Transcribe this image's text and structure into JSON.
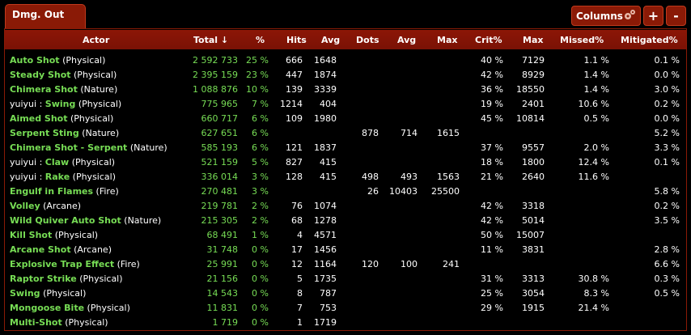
{
  "tab": {
    "label": "Dmg. Out"
  },
  "toolbar": {
    "columns_label": "Columns",
    "plus_label": "+",
    "minus_label": "-"
  },
  "columns": [
    "Actor",
    "Total ↓",
    "%",
    "Hits",
    "Avg",
    "Dots",
    "Avg",
    "Max",
    "Crit%",
    "Max",
    "Missed%",
    "Mitigated%"
  ],
  "rows": [
    {
      "owner": "",
      "skill": "Auto Shot",
      "school": "(Physical)",
      "total": "2 592 733",
      "pct": "25 %",
      "hits": "666",
      "avg": "1648",
      "dots": "",
      "davg": "",
      "dmax": "",
      "crit": "40 %",
      "max": "7129",
      "missed": "1.1 %",
      "mitig": "0.1 %"
    },
    {
      "owner": "",
      "skill": "Steady Shot",
      "school": "(Physical)",
      "total": "2 395 159",
      "pct": "23 %",
      "hits": "447",
      "avg": "1874",
      "dots": "",
      "davg": "",
      "dmax": "",
      "crit": "42 %",
      "max": "8929",
      "missed": "1.4 %",
      "mitig": "0.0 %"
    },
    {
      "owner": "",
      "skill": "Chimera Shot",
      "school": "(Nature)",
      "total": "1 088 876",
      "pct": "10 %",
      "hits": "139",
      "avg": "3339",
      "dots": "",
      "davg": "",
      "dmax": "",
      "crit": "36 %",
      "max": "18550",
      "missed": "1.4 %",
      "mitig": "3.0 %"
    },
    {
      "owner": "yuiyui : ",
      "skill": "Swing",
      "school": "(Physical)",
      "total": "775 965",
      "pct": "7 %",
      "hits": "1214",
      "avg": "404",
      "dots": "",
      "davg": "",
      "dmax": "",
      "crit": "19 %",
      "max": "2401",
      "missed": "10.6 %",
      "mitig": "0.2 %"
    },
    {
      "owner": "",
      "skill": "Aimed Shot",
      "school": "(Physical)",
      "total": "660 717",
      "pct": "6 %",
      "hits": "109",
      "avg": "1980",
      "dots": "",
      "davg": "",
      "dmax": "",
      "crit": "45 %",
      "max": "10814",
      "missed": "0.5 %",
      "mitig": "0.0 %"
    },
    {
      "owner": "",
      "skill": "Serpent Sting",
      "school": "(Nature)",
      "total": "627 651",
      "pct": "6 %",
      "hits": "",
      "avg": "",
      "dots": "878",
      "davg": "714",
      "dmax": "1615",
      "crit": "",
      "max": "",
      "missed": "",
      "mitig": "5.2 %"
    },
    {
      "owner": "",
      "skill": "Chimera Shot - Serpent",
      "school": "(Nature)",
      "total": "585 193",
      "pct": "6 %",
      "hits": "121",
      "avg": "1837",
      "dots": "",
      "davg": "",
      "dmax": "",
      "crit": "37 %",
      "max": "9557",
      "missed": "2.0 %",
      "mitig": "3.3 %"
    },
    {
      "owner": "yuiyui : ",
      "skill": "Claw",
      "school": "(Physical)",
      "total": "521 159",
      "pct": "5 %",
      "hits": "827",
      "avg": "415",
      "dots": "",
      "davg": "",
      "dmax": "",
      "crit": "18 %",
      "max": "1800",
      "missed": "12.4 %",
      "mitig": "0.1 %"
    },
    {
      "owner": "yuiyui : ",
      "skill": "Rake",
      "school": "(Physical)",
      "total": "336 014",
      "pct": "3 %",
      "hits": "128",
      "avg": "415",
      "dots": "498",
      "davg": "493",
      "dmax": "1563",
      "crit": "21 %",
      "max": "2640",
      "missed": "11.6 %",
      "mitig": ""
    },
    {
      "owner": "",
      "skill": "Engulf in Flames",
      "school": "(Fire)",
      "total": "270 481",
      "pct": "3 %",
      "hits": "",
      "avg": "",
      "dots": "26",
      "davg": "10403",
      "dmax": "25500",
      "crit": "",
      "max": "",
      "missed": "",
      "mitig": "5.8 %"
    },
    {
      "owner": "",
      "skill": "Volley",
      "school": "(Arcane)",
      "total": "219 781",
      "pct": "2 %",
      "hits": "76",
      "avg": "1074",
      "dots": "",
      "davg": "",
      "dmax": "",
      "crit": "42 %",
      "max": "3318",
      "missed": "",
      "mitig": "0.2 %"
    },
    {
      "owner": "",
      "skill": "Wild Quiver Auto Shot",
      "school": "(Nature)",
      "total": "215 305",
      "pct": "2 %",
      "hits": "68",
      "avg": "1278",
      "dots": "",
      "davg": "",
      "dmax": "",
      "crit": "42 %",
      "max": "5014",
      "missed": "",
      "mitig": "3.5 %"
    },
    {
      "owner": "",
      "skill": "Kill Shot",
      "school": "(Physical)",
      "total": "68 491",
      "pct": "1 %",
      "hits": "4",
      "avg": "4571",
      "dots": "",
      "davg": "",
      "dmax": "",
      "crit": "50 %",
      "max": "15007",
      "missed": "",
      "mitig": ""
    },
    {
      "owner": "",
      "skill": "Arcane Shot",
      "school": "(Arcane)",
      "total": "31 748",
      "pct": "0 %",
      "hits": "17",
      "avg": "1456",
      "dots": "",
      "davg": "",
      "dmax": "",
      "crit": "11 %",
      "max": "3831",
      "missed": "",
      "mitig": "2.8 %"
    },
    {
      "owner": "",
      "skill": "Explosive Trap Effect",
      "school": "(Fire)",
      "total": "25 991",
      "pct": "0 %",
      "hits": "12",
      "avg": "1164",
      "dots": "120",
      "davg": "100",
      "dmax": "241",
      "crit": "",
      "max": "",
      "missed": "",
      "mitig": "6.6 %"
    },
    {
      "owner": "",
      "skill": "Raptor Strike",
      "school": "(Physical)",
      "total": "21 156",
      "pct": "0 %",
      "hits": "5",
      "avg": "1735",
      "dots": "",
      "davg": "",
      "dmax": "",
      "crit": "31 %",
      "max": "3313",
      "missed": "30.8 %",
      "mitig": "0.3 %"
    },
    {
      "owner": "",
      "skill": "Swing",
      "school": "(Physical)",
      "total": "14 543",
      "pct": "0 %",
      "hits": "8",
      "avg": "787",
      "dots": "",
      "davg": "",
      "dmax": "",
      "crit": "25 %",
      "max": "3054",
      "missed": "8.3 %",
      "mitig": "0.5 %"
    },
    {
      "owner": "",
      "skill": "Mongoose Bite",
      "school": "(Physical)",
      "total": "11 831",
      "pct": "0 %",
      "hits": "7",
      "avg": "753",
      "dots": "",
      "davg": "",
      "dmax": "",
      "crit": "29 %",
      "max": "1915",
      "missed": "21.4 %",
      "mitig": ""
    },
    {
      "owner": "",
      "skill": "Multi-Shot",
      "school": "(Physical)",
      "total": "1 719",
      "pct": "0 %",
      "hits": "1",
      "avg": "1719",
      "dots": "",
      "davg": "",
      "dmax": "",
      "crit": "",
      "max": "",
      "missed": "",
      "mitig": ""
    }
  ]
}
